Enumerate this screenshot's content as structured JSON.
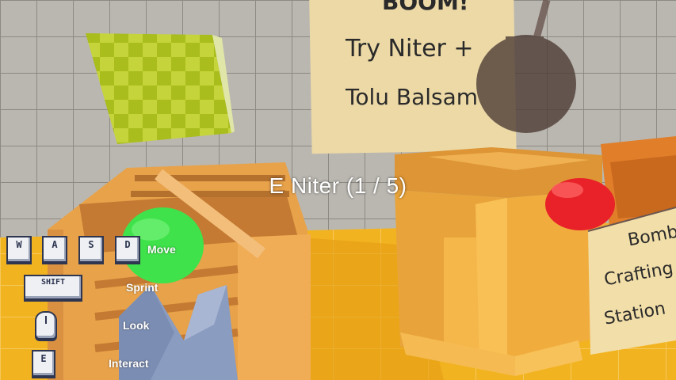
{
  "scene": {
    "poster_heading": "BOOM!",
    "poster_line1": "Try Niter +",
    "poster_line2": "Tolu Balsam",
    "station_sign_line1": "Bomb",
    "station_sign_line2": "Crafting",
    "station_sign_line3": "Station"
  },
  "hud": {
    "interact_prompt": "E  Niter (1 / 5)"
  },
  "controls": {
    "keys": [
      "W",
      "A",
      "S",
      "D"
    ],
    "move_label": "Move",
    "shift_key": "SHIFT",
    "sprint_label": "Sprint",
    "look_label": "Look",
    "interact_key": "E",
    "interact_label": "Interact"
  },
  "colors": {
    "crate": "#e8a43a",
    "floor": "#f2b321",
    "green_button": "#3fe24a",
    "red_button": "#e82228",
    "poster": "#ecd9a6"
  }
}
